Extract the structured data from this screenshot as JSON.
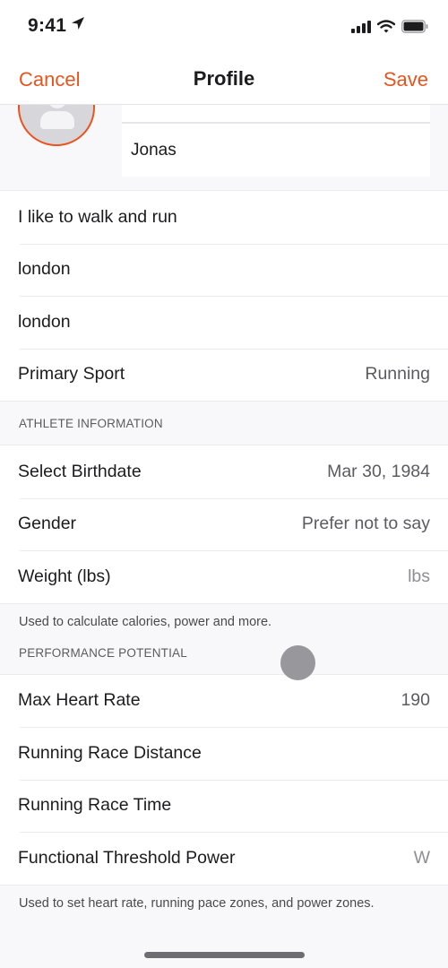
{
  "status_bar": {
    "time": "9:41",
    "icons": [
      "location-arrow-icon",
      "cellular-signal-icon",
      "wifi-icon",
      "battery-icon"
    ]
  },
  "nav": {
    "cancel_label": "Cancel",
    "title": "Profile",
    "save_label": "Save",
    "accent_color": "#e8541e"
  },
  "profile": {
    "avatar_icon": "person-placeholder-icon",
    "first_name": "",
    "last_name": "Jonas"
  },
  "about_rows": [
    {
      "label": "I like to walk and run",
      "value": ""
    },
    {
      "label": "london",
      "value": ""
    },
    {
      "label": "london",
      "value": ""
    },
    {
      "label": "Primary Sport",
      "value": "Running"
    }
  ],
  "athlete_section": {
    "header": "ATHLETE INFORMATION",
    "rows": [
      {
        "label": "Select Birthdate",
        "value": "Mar 30, 1984"
      },
      {
        "label": "Gender",
        "value": "Prefer not to say"
      },
      {
        "label": "Weight (lbs)",
        "value": "lbs"
      }
    ],
    "footer": "Used to calculate calories, power and more."
  },
  "performance_section": {
    "header": "PERFORMANCE POTENTIAL",
    "rows": [
      {
        "label": "Max Heart Rate",
        "value": "190"
      },
      {
        "label": "Running Race Distance",
        "value": ""
      },
      {
        "label": "Running Race Time",
        "value": ""
      },
      {
        "label": "Functional Threshold Power",
        "value": "W"
      }
    ],
    "footer": "Used to set heart rate, running pace zones, and power zones."
  }
}
